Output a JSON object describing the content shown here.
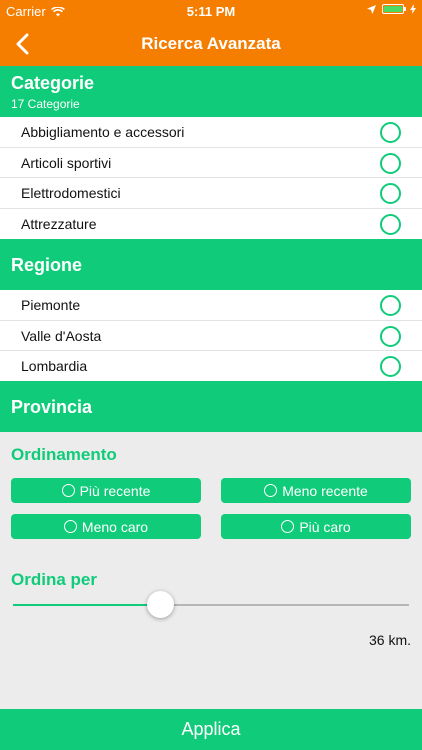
{
  "status": {
    "carrier": "Carrier",
    "time": "5:11 PM"
  },
  "navbar": {
    "title": "Ricerca Avanzata"
  },
  "categorie": {
    "title": "Categorie",
    "subtitle": "17 Categorie",
    "items": [
      {
        "label": "Abbigliamento e accessori"
      },
      {
        "label": "Articoli sportivi"
      },
      {
        "label": "Elettrodomestici"
      },
      {
        "label": "Attrezzature"
      }
    ]
  },
  "regione": {
    "title": "Regione",
    "items": [
      {
        "label": "Piemonte"
      },
      {
        "label": "Valle d'Aosta"
      },
      {
        "label": "Lombardia"
      }
    ]
  },
  "provincia": {
    "title": "Provincia"
  },
  "ordinamento": {
    "title": "Ordinamento",
    "options": [
      {
        "label": "Più recente"
      },
      {
        "label": "Meno recente"
      },
      {
        "label": "Meno caro"
      },
      {
        "label": "Più caro"
      }
    ]
  },
  "ordina_per": {
    "title": "Ordina per",
    "slider_fraction": 0.37,
    "distance": "36 km."
  },
  "apply": {
    "label": "Applica"
  },
  "colors": {
    "orange": "#f57d00",
    "green": "#10cc7a"
  }
}
